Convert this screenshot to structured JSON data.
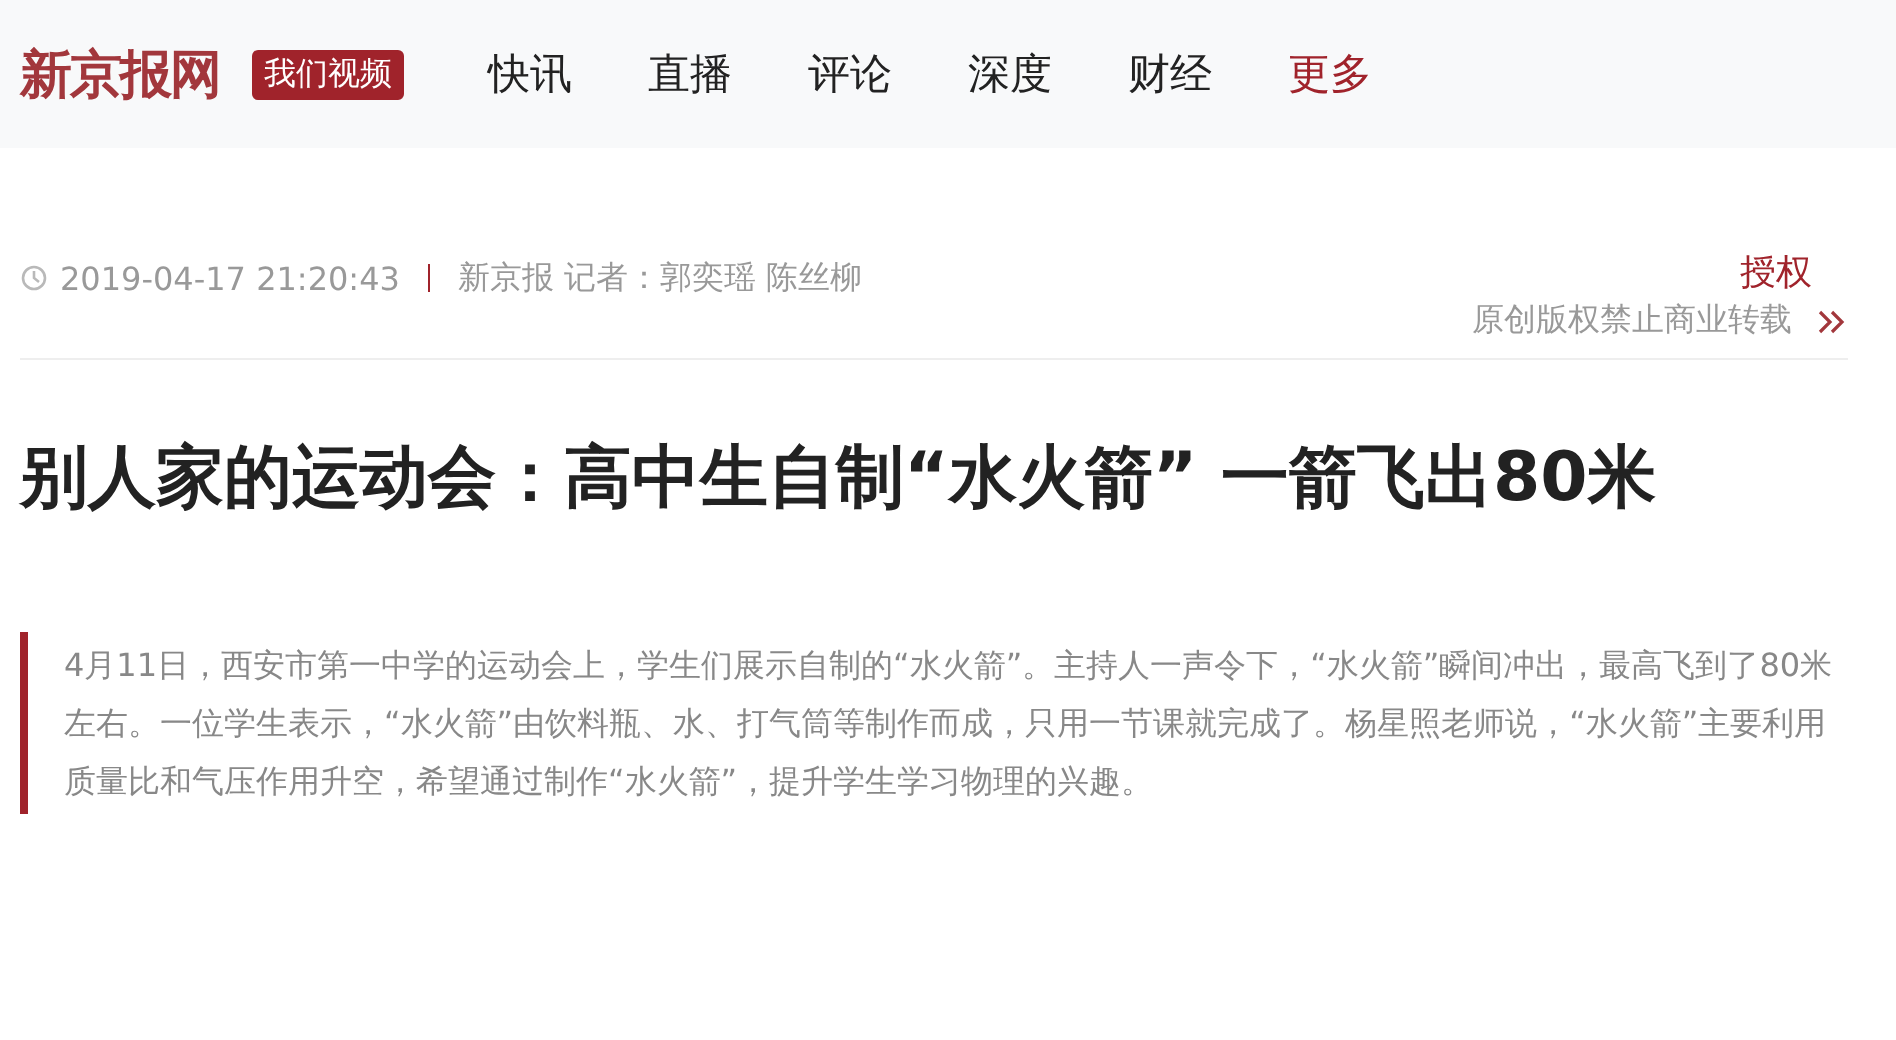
{
  "header": {
    "logo": "新京报网",
    "video_badge": "我们视频",
    "nav": [
      {
        "label": "快讯",
        "kind": "link"
      },
      {
        "label": "直播",
        "kind": "link"
      },
      {
        "label": "评论",
        "kind": "link"
      },
      {
        "label": "深度",
        "kind": "link"
      },
      {
        "label": "财经",
        "kind": "link"
      },
      {
        "label": "更多",
        "kind": "more"
      }
    ]
  },
  "meta": {
    "time": "2019-04-17 21:20:43",
    "source": "新京报 记者：郭奕瑶 陈丝柳",
    "license_link": "授权",
    "copyright": "原创版权禁止商业转载"
  },
  "article": {
    "title": "别人家的运动会：高中生自制“水火箭” 一箭飞出80米",
    "summary": "4月11日，西安市第一中学的运动会上，学生们展示自制的“水火箭”。主持人一声令下，“水火箭”瞬间冲出，最高飞到了80米左右。一位学生表示，“水火箭”由饮料瓶、水、打气筒等制作而成，只用一节课就完成了。杨星照老师说，“水火箭”主要利用质量比和气压作用升空，希望通过制作“水火箭”，提升学生学习物理的兴趣。"
  }
}
